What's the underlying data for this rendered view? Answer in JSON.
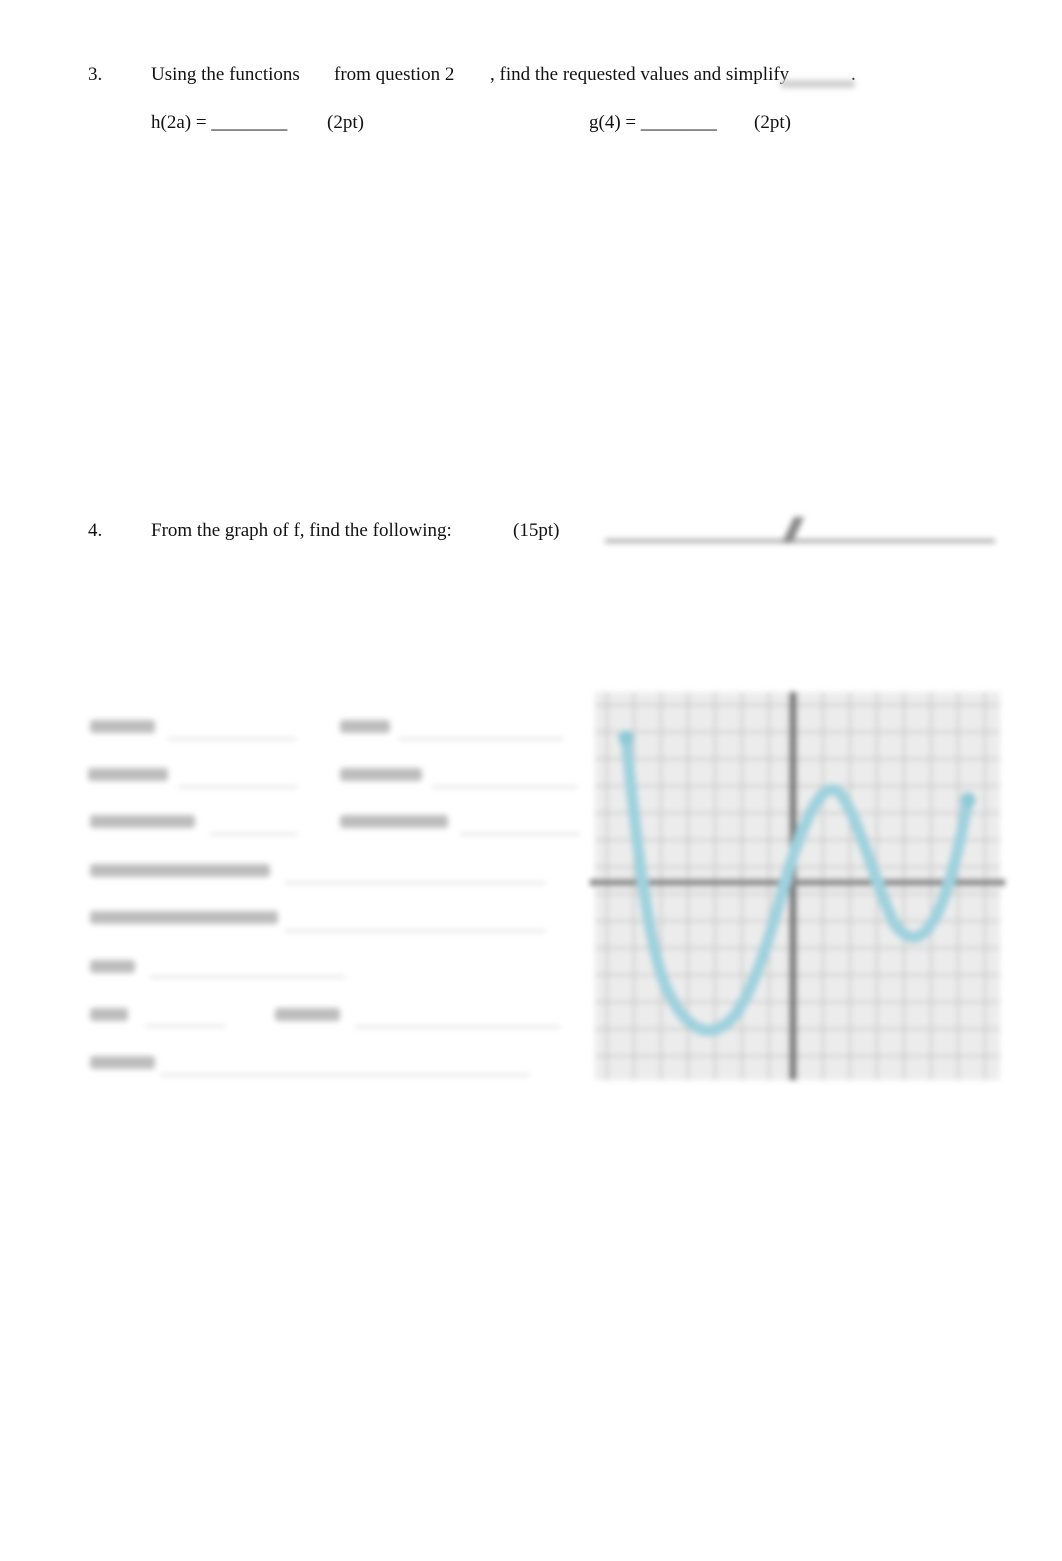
{
  "question3": {
    "number": "3.",
    "text_part1": "Using the functions",
    "text_part2": "from question 2",
    "text_part3": ", find the requested values and simplify",
    "text_end": ".",
    "item1": {
      "label": "h(2a) = ________",
      "points": "(2pt)"
    },
    "item2": {
      "label": "g(4) = ________",
      "points": "(2pt)"
    }
  },
  "question4": {
    "number": "4.",
    "text": "From the graph of f, find the following:",
    "points": "(15pt)",
    "graph": {
      "curve_color": "#8fcad8",
      "axis_color": "#6a6a6a",
      "grid_color": "#c8c8c8"
    }
  }
}
